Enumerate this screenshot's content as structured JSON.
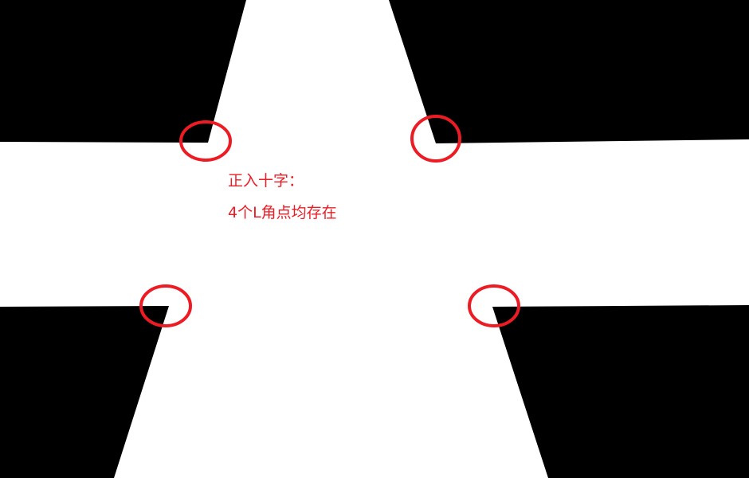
{
  "annotation": {
    "title": "正入十字：",
    "description": "4个L角点均存在"
  },
  "colors": {
    "track": "#ffffff",
    "background": "#000000",
    "marker": "#ed1c24"
  },
  "markers": [
    "top-left-corner",
    "top-right-corner",
    "bottom-left-corner",
    "bottom-right-corner"
  ]
}
